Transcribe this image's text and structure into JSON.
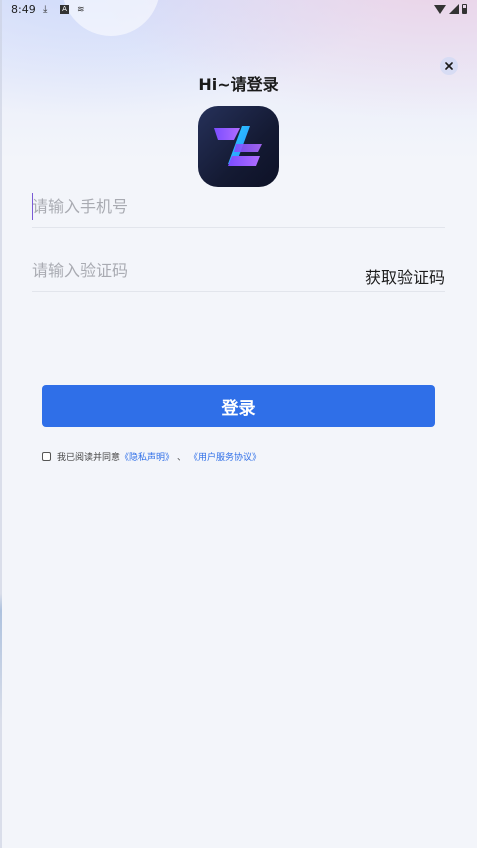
{
  "status_bar": {
    "time": "8:49",
    "left_icons": [
      "download-icon",
      "a-icon",
      "wave-icon"
    ],
    "right_icons": [
      "wifi-icon",
      "signal-icon",
      "battery-icon"
    ]
  },
  "header": {
    "title": "Hi~请登录",
    "close_icon": "close-icon"
  },
  "form": {
    "phone_placeholder": "请输入手机号",
    "phone_value": "",
    "code_placeholder": "请输入验证码",
    "code_value": "",
    "get_code_label": "获取验证码",
    "login_label": "登录"
  },
  "agreement": {
    "prefix": "我已阅读并同意",
    "privacy_link": "《隐私声明》",
    "separator": "、",
    "service_link": "《用户服务协议》",
    "checked": false
  },
  "colors": {
    "accent": "#2f6fe8",
    "background": "#f3f5fa",
    "logo_bg": "#141a33"
  }
}
